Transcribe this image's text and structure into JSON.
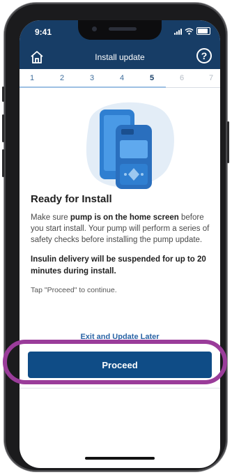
{
  "status": {
    "time": "9:41"
  },
  "header": {
    "title": "Install update",
    "help_label": "?"
  },
  "steps": [
    "1",
    "2",
    "3",
    "4",
    "5",
    "6",
    "7"
  ],
  "current_step": 5,
  "main": {
    "title": "Ready for Install",
    "para_lead": "Make sure ",
    "para_bold": "pump is on the home screen",
    "para_tail": " before you start install. Your pump will perform a series of safety checks before installing the pump update.",
    "warning": "Insulin delivery will be suspended for up to 20 minutes during install.",
    "hint": "Tap \"Proceed\" to continue."
  },
  "actions": {
    "exit_label": "Exit and Update Later",
    "proceed_label": "Proceed"
  },
  "colors": {
    "header": "#173d66",
    "button": "#0f4c86",
    "highlight": "#9a3c9a",
    "link": "#2a64a5"
  },
  "icons": [
    "home-icon",
    "help-icon",
    "wifi-icon",
    "battery-icon",
    "signal-icon",
    "pump-phone-illustration"
  ]
}
